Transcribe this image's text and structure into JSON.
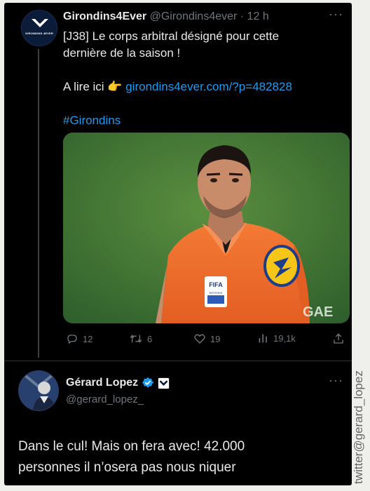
{
  "tweet1": {
    "display_name": "Girondins4Ever",
    "handle": "@Girondins4ever",
    "sep": " · ",
    "time": "12 h",
    "more": "···",
    "line1": "[J38] Le corps arbitral désigné pour cette",
    "line2": "dernière de la saison !",
    "read_prefix": "A lire ici",
    "pointing_emoji": "👉",
    "link": "girondins4ever.com/?p=482828",
    "hashtag": "#Girondins",
    "avatar_text": "GIRONDINS 4EVER",
    "media_badge_fifa": "FIFA",
    "media_badge_referee": "REFEREE",
    "media_watermark": "GAE",
    "actions": {
      "replies": "12",
      "retweets": "6",
      "likes": "19",
      "views": "19,1k"
    }
  },
  "tweet2": {
    "display_name": "Gérard Lopez",
    "handle": "@gerard_lopez_",
    "more": "···",
    "line1": "Dans le cul! Mais on fera avec! 42.000",
    "line2": "personnes il n’osera pas nous niquer"
  },
  "credit": "twitter@gerard_lopez",
  "colors": {
    "background": "#000000",
    "text": "#e7e9ea",
    "muted": "#71767b",
    "link": "#1d9bf0",
    "verified": "#1d9bf0",
    "referee_shirt": "#f26b2a",
    "pitch": "#3f7a34"
  },
  "icons": [
    "reply-icon",
    "retweet-icon",
    "like-icon",
    "views-icon",
    "share-icon",
    "verified-badge-icon",
    "affiliate-badge-icon",
    "pointing-hand-icon"
  ]
}
